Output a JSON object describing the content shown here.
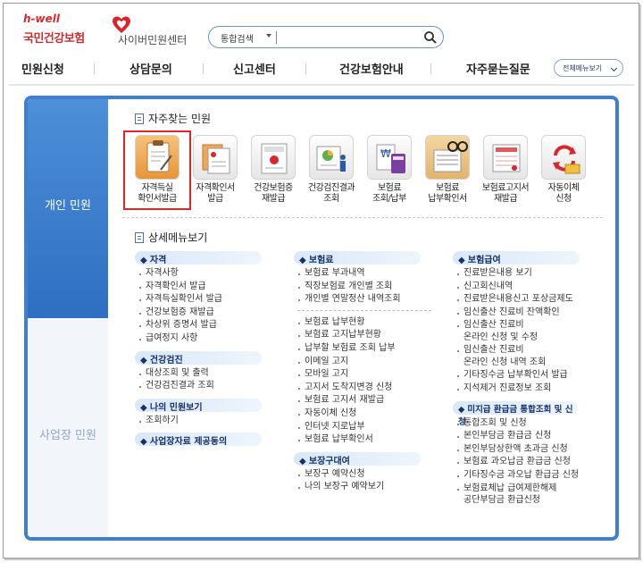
{
  "header": {
    "logo_tagline": "h-well",
    "logo_name": "국민건강보험",
    "site_name": "사이버민원센터",
    "search_scope": "통합검색",
    "search_value": "",
    "search_placeholder": ""
  },
  "nav": {
    "items": [
      "민원신청",
      "상담문의",
      "신고센터",
      "건강보험안내",
      "자주묻는질문"
    ],
    "all_menu": "전체메뉴보기"
  },
  "sidebar": {
    "personal": "개인 민원",
    "business": "사업장 민원"
  },
  "frequent": {
    "title": "자주찾는 민원",
    "items": [
      {
        "line1": "자격득실",
        "line2": "확인서발급",
        "icon": "certificate-clipboard-icon"
      },
      {
        "line1": "자격확인서",
        "line2": "발급",
        "icon": "certificate-document-icon"
      },
      {
        "line1": "건강보험증",
        "line2": "재발급",
        "icon": "insurance-card-icon"
      },
      {
        "line1": "건강검진결과",
        "line2": "조회",
        "icon": "checkup-result-icon"
      },
      {
        "line1": "보험료",
        "line2": "조회/납부",
        "icon": "payment-calculator-icon"
      },
      {
        "line1": "보험료",
        "line2": "납부확인서",
        "icon": "receipt-glasses-icon"
      },
      {
        "line1": "보험료고지서",
        "line2": "재발급",
        "icon": "bill-reissue-icon"
      },
      {
        "line1": "자동이체",
        "line2": "신청",
        "icon": "auto-transfer-icon"
      }
    ]
  },
  "detail": {
    "title": "상세메뉴보기",
    "col1": [
      {
        "cat": "자격",
        "links": [
          "자격사항",
          "자격확인서 발급",
          "자격득실확인서 발급",
          "건강보험증 재발급",
          "차상위 증명서 발급",
          "급여정지 사항"
        ]
      },
      {
        "cat": "건강검진",
        "links": [
          "대상조회 및 출력",
          "건강검진결과 조회"
        ]
      },
      {
        "cat": "나의 민원보기",
        "links": [
          "조회하기"
        ]
      },
      {
        "cat": "사업장자료 제공동의",
        "links": []
      }
    ],
    "col2": {
      "cat1": "보험료",
      "group1": [
        "보험료 부과내역",
        "직장보험료 개인별 조회",
        "개인별 연말정산 내역조회"
      ],
      "group2": [
        "보험료 납부현황",
        "보험료 고지납부현황",
        "납부할 보험료 조회 납부",
        "이메일 고지",
        "모바일 고지",
        "고지서 도착지변경 신청",
        "보험료 고지서 재발급",
        "자동이체 신청",
        "인터넷 지로납부",
        "보험료 납부확인서"
      ],
      "cat2": "보장구대여",
      "group3": [
        "보장구 예약신청",
        "나의 보장구 예약보기"
      ]
    },
    "col3": {
      "cat1": "보험급여",
      "group1": [
        "진료받은내용 보기",
        "신고회신내역",
        "진료받은내용신고 포상금제도",
        "임신출산 진료비 잔액확인"
      ],
      "two1": [
        "임신출산 진료비",
        "온라인 신청 및 수정"
      ],
      "two2": [
        "임신출산 진료비",
        "온라인 신청 내역 조회"
      ],
      "group2": [
        "기타징수금 납부확인서 발급",
        "지석제거 진료정보 조회"
      ],
      "cat2": "미지급 환급금 통합조회 및 신청",
      "group3": [
        "통합조회 및 신청",
        "본인부담금 환급금 신청",
        "본인부담상한액 초과금 신청",
        "보험료 과오납금 환급금 신청",
        "기타징수금 과오납 환급금 신청"
      ],
      "two3": [
        "보험료체납 급여제한해제",
        "공단부담금 환급신청"
      ]
    }
  }
}
